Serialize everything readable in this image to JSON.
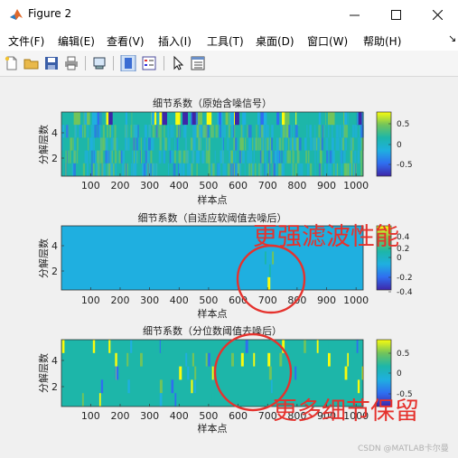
{
  "window": {
    "title": "Figure 2"
  },
  "menu": [
    "文件(F)",
    "编辑(E)",
    "查看(V)",
    "插入(I)",
    "工具(T)",
    "桌面(D)",
    "窗口(W)",
    "帮助(H)"
  ],
  "toolbar": [
    "new-file-icon",
    "open-folder-icon",
    "save-icon",
    "print-icon",
    "print-preview-icon",
    "link-plot-icon",
    "insert-colorbar-icon",
    "insert-legend-icon",
    "pointer-icon",
    "property-editor-icon"
  ],
  "colors": {
    "parula_dark": "#3e26a8",
    "parula_blue": "#2f6ef0",
    "parula_cyan": "#1fafe0",
    "parula_teal": "#1db6a9",
    "parula_green": "#72c45b",
    "parula_yellow": "#f9fb0e",
    "annotation_red": "#e5322d"
  },
  "chart_data": [
    {
      "type": "heatmap",
      "title": "细节系数（原始含噪信号）",
      "xlabel": "样本点",
      "ylabel": "分解层数",
      "xticks": [
        100,
        200,
        300,
        400,
        500,
        600,
        700,
        800,
        900,
        1000
      ],
      "yticks": [
        2,
        4
      ],
      "xlim": [
        1,
        1024
      ],
      "ylim": [
        0.5,
        5.5
      ],
      "colorbar_ticks": [
        0.5,
        0,
        -0.5
      ],
      "clim": [
        -0.9,
        0.9
      ]
    },
    {
      "type": "heatmap",
      "title": "细节系数（自适应软阈值去噪后）",
      "xlabel": "样本点",
      "ylabel": "分解层数",
      "xticks": [
        100,
        200,
        300,
        400,
        500,
        600,
        700,
        800,
        900,
        1000
      ],
      "yticks": [
        2,
        4
      ],
      "xlim": [
        1,
        1024
      ],
      "ylim": [
        0.5,
        5.5
      ],
      "colorbar_ticks": [
        0.4,
        0.2,
        0,
        -0.2,
        -0.4
      ],
      "clim": [
        -0.45,
        0.45
      ]
    },
    {
      "type": "heatmap",
      "title": "细节系数（分位数阈值去噪后）",
      "xlabel": "样本点",
      "ylabel": "分解层数",
      "xticks": [
        100,
        200,
        300,
        400,
        500,
        600,
        700,
        800,
        900,
        1000
      ],
      "yticks": [
        2,
        4
      ],
      "xlim": [
        1,
        1024
      ],
      "ylim": [
        0.5,
        5.5
      ],
      "colorbar_ticks": [
        0.5,
        0,
        -0.5
      ],
      "clim": [
        -0.9,
        0.9
      ]
    }
  ],
  "annotations": [
    "更强滤波性能",
    "更多细节保留"
  ],
  "watermark": "CSDN @MATLAB卡尔曼"
}
